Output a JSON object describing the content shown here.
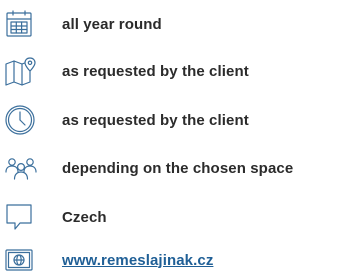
{
  "items": [
    {
      "icon": "calendar-icon",
      "text": "all year round"
    },
    {
      "icon": "map-pin-icon",
      "text": "as requested by the client"
    },
    {
      "icon": "clock-icon",
      "text": "as requested by the client"
    },
    {
      "icon": "people-group-icon",
      "text": "depending on the chosen space"
    },
    {
      "icon": "speech-bubble-icon",
      "text": "Czech"
    },
    {
      "icon": "globe-window-icon",
      "text": "www.remeslajinak.cz"
    }
  ],
  "colors": {
    "icon_stroke": "#3b6f9c",
    "text": "#2b2b2b",
    "link": "#1f5f96"
  }
}
